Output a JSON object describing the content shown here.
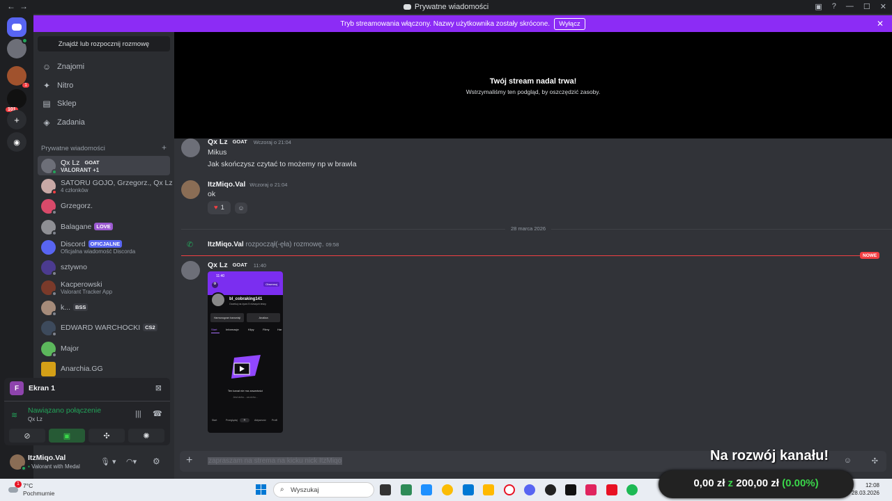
{
  "window": {
    "title": "Prywatne wiadomości",
    "controls": [
      "window-icon",
      "help-icon",
      "minimize-icon",
      "maximize-icon",
      "close-icon"
    ]
  },
  "banner": {
    "text": "Tryb streamowania włączony. Nazwy użytkownika zostały skrócone.",
    "button": "Wyłącz"
  },
  "guilds": {
    "badge1": "1",
    "badge2": "101"
  },
  "sidebar": {
    "search_placeholder": "Znajdź lub rozpocznij rozmowę",
    "nav": [
      {
        "label": "Znajomi",
        "icon": "friends-icon"
      },
      {
        "label": "Nitro",
        "icon": "nitro-icon"
      },
      {
        "label": "Sklep",
        "icon": "shop-icon"
      },
      {
        "label": "Zadania",
        "icon": "quests-icon"
      }
    ],
    "section_title": "Prywatne wiadomości",
    "add": "+",
    "dms": [
      {
        "name": "Qx Lz",
        "tag": "GOAT",
        "sub": "VALORANT +1"
      },
      {
        "name": "SATORU GOJO, Grzegorz., Qx Lz",
        "sub": "4 członków"
      },
      {
        "name": "Grzegorz."
      },
      {
        "name": "Balagane",
        "tag": "LOVE"
      },
      {
        "name": "Discord",
        "tag": "OFICJALNE",
        "sub": "Oficjalna wiadomość Discorda"
      },
      {
        "name": "sztywno"
      },
      {
        "name": "Kacperowski",
        "sub": "Valorant Tracker App"
      },
      {
        "name": "k...",
        "tag": "BSS"
      },
      {
        "name": "EDWARD WARCHOCKI",
        "tag": "CS2"
      },
      {
        "name": "Major"
      },
      {
        "name": "Anarchia.GG"
      }
    ]
  },
  "voice": {
    "screen_label": "Ekran 1",
    "screen_avatar": "F",
    "status": "Nawiązano połączenie",
    "channel": "Qx Lz"
  },
  "user": {
    "name": "ItzMiqo.Val",
    "status": "Valorant with Medal"
  },
  "stream": {
    "title": "Twój stream nadal trwa!",
    "subtitle": "Wstrzymaliśmy ten podgląd, by oszczędzić zasoby."
  },
  "chat": {
    "m1": {
      "author": "Qx Lz",
      "tag": "GOAT",
      "time": "Wczoraj o 21:04",
      "lines": [
        "Mikus",
        "Jak skończysz czytać to możemy np w brawla"
      ]
    },
    "m2": {
      "author": "ItzMiqo.Val",
      "time": "Wczoraj o 21:04",
      "text": "ok",
      "reaction_count": "1"
    },
    "divider": "28 marca 2026",
    "call": {
      "author": "ItzMiqo.Val",
      "text": "rozpoczął(-ęła) rozmowę.",
      "time": "09:58"
    },
    "new_label": "NOWE",
    "m3": {
      "author": "Qx Lz",
      "tag": "GOAT",
      "time": "11:40"
    },
    "image": {
      "clock": "11:40",
      "follow_btn": "Obserwuj",
      "profile_name": "bl_cobraking141",
      "profile_sub": "Oczekuj na żywo 5 niższych leśny",
      "btn1": "Harmonogram transmisji",
      "btn2": "Analiza",
      "tabs": [
        "Start",
        "Informacje",
        "Klipy",
        "Filmy",
        "Har"
      ],
      "empty_title": "Ten kanał nie ma zawartości",
      "empty_sub": "Jest cicho... za cicho...",
      "nav": [
        "Start",
        "Przeglądaj",
        "+",
        "Aktywność",
        "Profil"
      ]
    },
    "input_value": "zapraszam na strema na kicku nick ItzMiqo"
  },
  "overlay": {
    "title": "Na rozwój kanału!",
    "amount": "0,00 zł",
    "sep": "z",
    "goal": "200,00 zł",
    "percent": "(0.00%)"
  },
  "taskbar": {
    "weather_temp": "7°C",
    "weather_desc": "Pochmurnie",
    "weather_badge": "1",
    "search": "Wyszukaj",
    "time": "12:08",
    "date": "28.03.2026"
  },
  "colors": {
    "banner": "#8c2cf5",
    "online": "#23a55a",
    "mention": "#f23f43",
    "overlay_green": "#3ad64a"
  }
}
